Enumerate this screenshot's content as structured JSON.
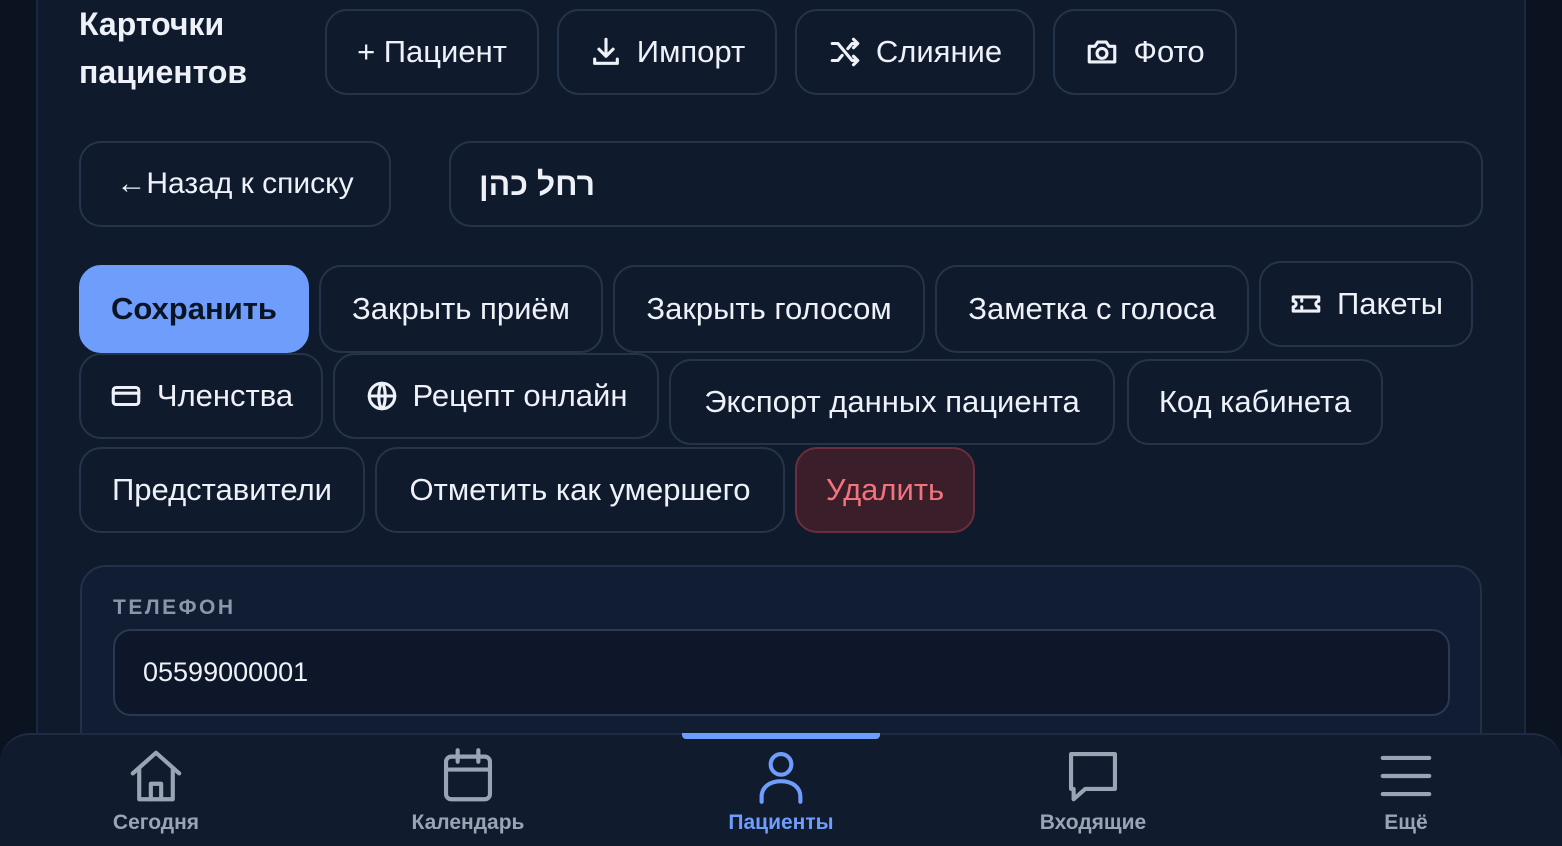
{
  "header": {
    "title": "Карточки пациентов",
    "buttons": {
      "add_patient": "+ Пациент",
      "import": "Импорт",
      "merge": "Слияние",
      "photo": "Фото"
    }
  },
  "nav": {
    "back_label": "←Назад к списку",
    "patient_name": "רחל כהן"
  },
  "actions": {
    "save": "Сохранить",
    "close_visit": "Закрыть приём",
    "close_by_voice": "Закрыть голосом",
    "voice_note": "Заметка с голоса",
    "packages": "Пакеты",
    "memberships": "Членства",
    "prescription_online": "Рецепт онлайн",
    "export_data": "Экспорт данных пациента",
    "office_code": "Код кабинета",
    "representatives": "Представители",
    "mark_deceased": "Отметить как умершего",
    "delete": "Удалить"
  },
  "phone": {
    "label": "ТЕЛЕФОН",
    "value": "05599000001"
  },
  "bottom_nav": {
    "today": "Сегодня",
    "calendar": "Календарь",
    "patients": "Пациенты",
    "inbox": "Входящие",
    "more": "Ещё",
    "active": "patients"
  },
  "colors": {
    "accent": "#6f9dfb",
    "danger": "#f2727e",
    "background": "#0f1a2c"
  }
}
